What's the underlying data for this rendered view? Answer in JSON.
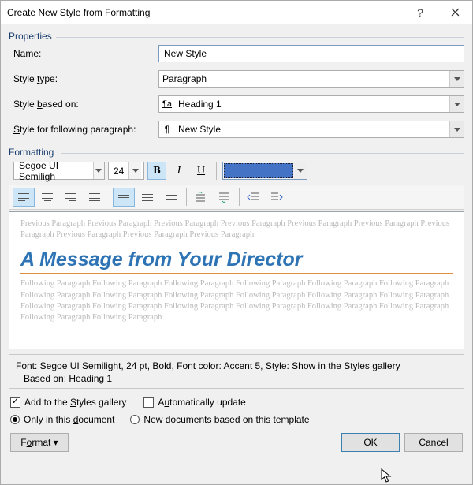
{
  "titlebar": {
    "title": "Create New Style from Formatting"
  },
  "sections": {
    "properties": "Properties",
    "formatting": "Formatting"
  },
  "props": {
    "name_label_pre": "",
    "name_u": "N",
    "name_label_post": "ame:",
    "name_value": "New Style",
    "type_label_pre": "Style ",
    "type_u": "t",
    "type_label_post": "ype:",
    "type_value": "Paragraph",
    "based_label_pre": "Style ",
    "based_u": "b",
    "based_label_post": "ased on:",
    "based_value": "Heading 1",
    "follow_label_pre": "",
    "follow_u": "S",
    "follow_label_post": "tyle for following paragraph:",
    "follow_value": "New Style"
  },
  "fmt": {
    "font": "Segoe UI Semiligh",
    "size": "24",
    "bold": "B",
    "italic": "I",
    "underline": "U",
    "color": "#4472C4"
  },
  "preview": {
    "prev_text": "Previous Paragraph Previous Paragraph Previous Paragraph Previous Paragraph Previous Paragraph Previous Paragraph Previous Paragraph Previous Paragraph Previous Paragraph Previous Paragraph",
    "heading": "A Message from Your Director",
    "foll": "Following Paragraph Following Paragraph Following Paragraph Following Paragraph Following Paragraph Following Paragraph Following Paragraph Following Paragraph Following Paragraph Following Paragraph Following Paragraph Following Paragraph Following Paragraph Following Paragraph Following Paragraph Following Paragraph Following Paragraph Following Paragraph Following Paragraph Following Paragraph"
  },
  "description": {
    "line1": "Font: Segoe UI Semilight, 24 pt, Bold, Font color: Accent 5, Style: Show in the Styles gallery",
    "line2": "   Based on: Heading 1"
  },
  "checks": {
    "add_pre": "Add to the ",
    "add_u": "S",
    "add_post": "tyles gallery",
    "auto_pre": "A",
    "auto_u": "u",
    "auto_post": "tomatically update"
  },
  "radios": {
    "only": "Only in this document",
    "only_u": "d",
    "tmpl": "New documents based on this template"
  },
  "buttons": {
    "format_pre": "F",
    "format_u": "o",
    "format_post": "rmat ▾",
    "ok": "OK",
    "cancel": "Cancel"
  }
}
